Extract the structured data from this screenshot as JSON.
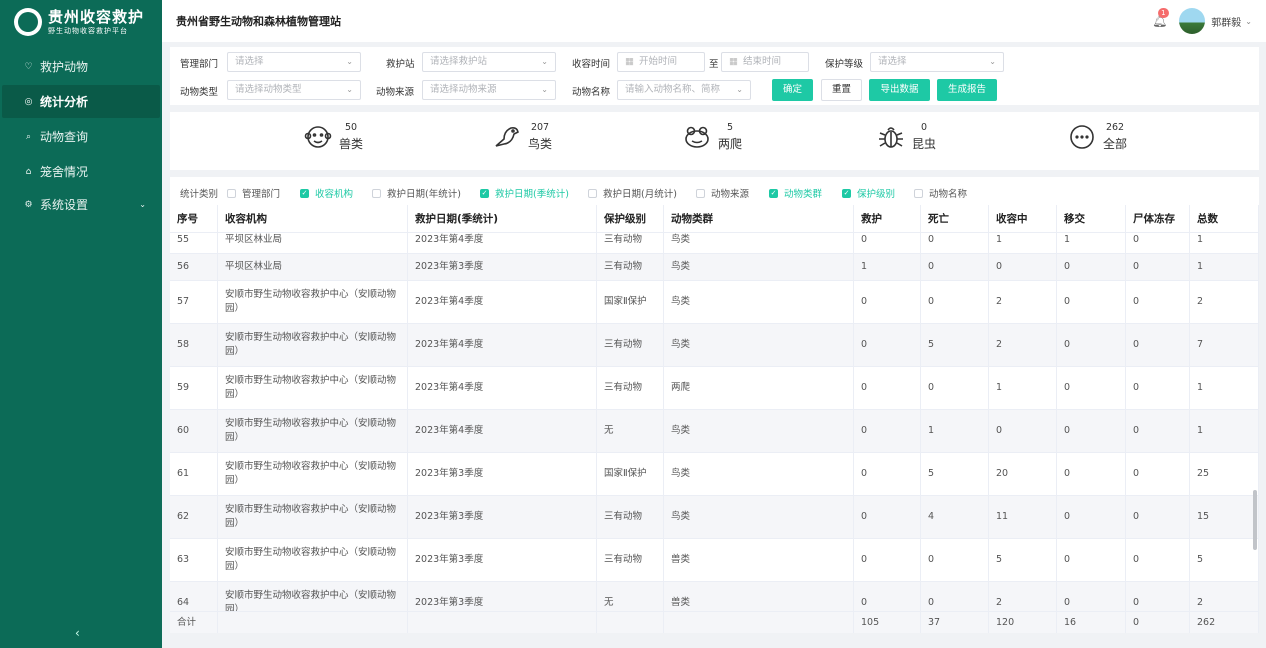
{
  "sidebar": {
    "logo_title": "贵州收容救护",
    "logo_subtitle": "野生动物收容救护平台",
    "items": [
      {
        "label": "救护动物",
        "icon": "♡"
      },
      {
        "label": "统计分析",
        "icon": "◎"
      },
      {
        "label": "动物查询",
        "icon": "⌕"
      },
      {
        "label": "笼舍情况",
        "icon": "⌂"
      },
      {
        "label": "系统设置",
        "icon": "⚙"
      }
    ],
    "collapse": "‹"
  },
  "header": {
    "title": "贵州省野生动物和森林植物管理站",
    "notification_count": "1",
    "username": "郭群毅"
  },
  "filters": {
    "dept_label": "管理部门",
    "dept_placeholder": "请选择",
    "station_label": "救护站",
    "station_placeholder": "请选择救护站",
    "time_label": "收容时间",
    "start_placeholder": "开始时间",
    "to": "至",
    "end_placeholder": "结束时间",
    "level_label": "保护等级",
    "level_placeholder": "请选择",
    "type_label": "动物类型",
    "type_placeholder": "请选择动物类型",
    "source_label": "动物来源",
    "source_placeholder": "请选择动物来源",
    "name_label": "动物名称",
    "name_placeholder": "请输入动物名称、简称",
    "confirm": "确定",
    "reset": "重置",
    "export": "导出数据",
    "report": "生成报告"
  },
  "stats": [
    {
      "name": "兽类",
      "count": "50"
    },
    {
      "name": "鸟类",
      "count": "207"
    },
    {
      "name": "两爬",
      "count": "5"
    },
    {
      "name": "昆虫",
      "count": "0"
    },
    {
      "name": "全部",
      "count": "262"
    }
  ],
  "categories": {
    "label": "统计类别",
    "options": [
      {
        "label": "管理部门",
        "checked": false
      },
      {
        "label": "收容机构",
        "checked": true
      },
      {
        "label": "救护日期(年统计)",
        "checked": false
      },
      {
        "label": "救护日期(季统计)",
        "checked": true
      },
      {
        "label": "救护日期(月统计)",
        "checked": false
      },
      {
        "label": "动物来源",
        "checked": false
      },
      {
        "label": "动物类群",
        "checked": true
      },
      {
        "label": "保护级别",
        "checked": true
      },
      {
        "label": "动物名称",
        "checked": false
      }
    ]
  },
  "table": {
    "headers": [
      "序号",
      "收容机构",
      "救护日期(季统计)",
      "保护级别",
      "动物类群",
      "救护",
      "死亡",
      "收容中",
      "移交",
      "尸体冻存",
      "总数"
    ],
    "rows": [
      [
        "55",
        "平坝区林业局",
        "2023年第4季度",
        "三有动物",
        "鸟类",
        "0",
        "0",
        "1",
        "1",
        "0",
        "1"
      ],
      [
        "56",
        "平坝区林业局",
        "2023年第3季度",
        "三有动物",
        "鸟类",
        "1",
        "0",
        "0",
        "0",
        "0",
        "1"
      ],
      [
        "57",
        "安顺市野生动物收容救护中心（安顺动物园）",
        "2023年第4季度",
        "国家Ⅱ保护",
        "鸟类",
        "0",
        "0",
        "2",
        "0",
        "0",
        "2"
      ],
      [
        "58",
        "安顺市野生动物收容救护中心（安顺动物园）",
        "2023年第4季度",
        "三有动物",
        "鸟类",
        "0",
        "5",
        "2",
        "0",
        "0",
        "7"
      ],
      [
        "59",
        "安顺市野生动物收容救护中心（安顺动物园）",
        "2023年第4季度",
        "三有动物",
        "两爬",
        "0",
        "0",
        "1",
        "0",
        "0",
        "1"
      ],
      [
        "60",
        "安顺市野生动物收容救护中心（安顺动物园）",
        "2023年第4季度",
        "无",
        "鸟类",
        "0",
        "1",
        "0",
        "0",
        "0",
        "1"
      ],
      [
        "61",
        "安顺市野生动物收容救护中心（安顺动物园）",
        "2023年第3季度",
        "国家Ⅱ保护",
        "鸟类",
        "0",
        "5",
        "20",
        "0",
        "0",
        "25"
      ],
      [
        "62",
        "安顺市野生动物收容救护中心（安顺动物园）",
        "2023年第3季度",
        "三有动物",
        "鸟类",
        "0",
        "4",
        "11",
        "0",
        "0",
        "15"
      ],
      [
        "63",
        "安顺市野生动物收容救护中心（安顺动物园）",
        "2023年第3季度",
        "三有动物",
        "兽类",
        "0",
        "0",
        "5",
        "0",
        "0",
        "5"
      ],
      [
        "64",
        "安顺市野生动物收容救护中心（安顺动物园）",
        "2023年第3季度",
        "无",
        "兽类",
        "0",
        "0",
        "2",
        "0",
        "0",
        "2"
      ]
    ],
    "footer": [
      "合计",
      "",
      "",
      "",
      "",
      "105",
      "37",
      "120",
      "16",
      "0",
      "262"
    ]
  }
}
